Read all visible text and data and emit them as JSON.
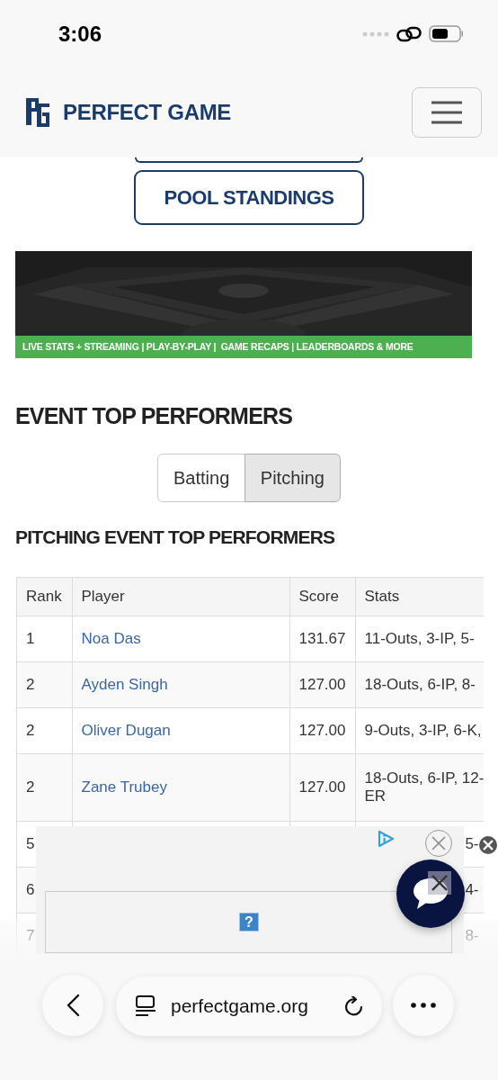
{
  "status_bar": {
    "time": "3:06"
  },
  "header": {
    "brand": "PERFECT GAME"
  },
  "nav_buttons": [
    {
      "kind": "cut"
    },
    {
      "kind": "full",
      "label": "POOL STANDINGS"
    }
  ],
  "banner": {
    "caption": "LIVE STATS + STREAMING | PLAY-BY-PLAY |  GAME RECAPS | LEADERBOARDS & MORE"
  },
  "section_title": "EVENT TOP PERFORMERS",
  "toggle": [
    {
      "label": "Batting",
      "selected": false
    },
    {
      "label": "Pitching",
      "selected": true
    }
  ],
  "table": {
    "title": "PITCHING EVENT TOP PERFORMERS",
    "columns": [
      "Rank",
      "Player",
      "Score",
      "Stats"
    ],
    "rows": [
      {
        "kind": "full",
        "rank": "1",
        "player": "Noa Das",
        "score": "131.67",
        "stats": [
          "11-Outs, 3-IP, 5-"
        ]
      },
      {
        "kind": "full",
        "rank": "2",
        "player": "Ayden Singh",
        "score": "127.00",
        "stats": [
          "18-Outs, 6-IP, 8-"
        ]
      },
      {
        "kind": "full",
        "rank": "2",
        "player": "Oliver Dugan",
        "score": "127.00",
        "stats": [
          "9-Outs, 3-IP, 6-K,"
        ]
      },
      {
        "kind": "full",
        "rank": "2",
        "player": "Zane Trubey",
        "score": "127.00",
        "stats": [
          "18-Outs, 6-IP, 12-",
          "ER"
        ]
      },
      {
        "kind": "covered",
        "rank": "5",
        "stats": [
          "5-"
        ]
      },
      {
        "kind": "covered",
        "rank": "6",
        "stats": [
          "4-"
        ]
      },
      {
        "kind": "covered",
        "rank": "7",
        "stats": [
          "8-"
        ]
      }
    ]
  },
  "ad": {
    "image_glyph": "?"
  },
  "browser": {
    "url": "perfectgame.org"
  }
}
